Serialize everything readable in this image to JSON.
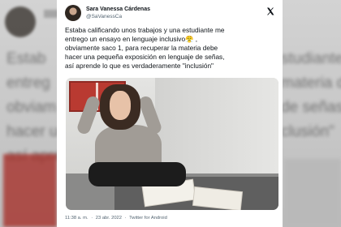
{
  "background": {
    "blurred_lines_left": [
      "Estab",
      "entreg",
      "obviam",
      "hacer un",
      "así apre"
    ],
    "blurred_lines_right": [
      "studiante me",
      "",
      "materia debe",
      "de señas,",
      "clusión\""
    ]
  },
  "tweet": {
    "author_name": "Sara Vanessa Cárdenas",
    "author_handle": "@SaVanessCa",
    "logo_icon": "x-logo-icon",
    "text": "Estaba calificando unos trabajos y una estudiante me\nentrego un ensayo en lenguaje inclusivo😤 ,\nobviamente saco 1, para recuperar la materia debe\nhacer una pequeña exposición en lenguaje de señas,\nasí aprende lo que es verdaderamente \"inclusión\"",
    "media": {
      "icon": "photo-woman-with-books"
    },
    "footer": {
      "time": "11:38 a. m.",
      "separator1": "·",
      "date": "23 abr. 2022",
      "separator2": "·",
      "source": "Twitter for Android"
    }
  }
}
